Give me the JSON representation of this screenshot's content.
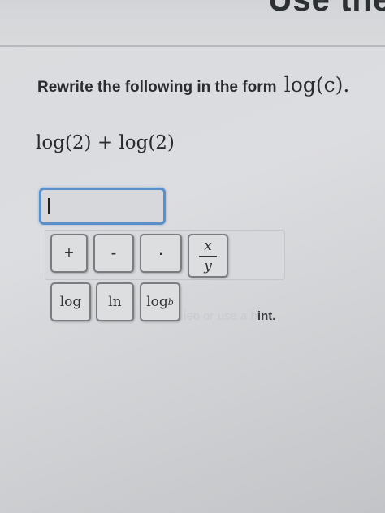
{
  "header": {
    "partial_heading": "Use the"
  },
  "question": {
    "prompt": "Rewrite the following in the form",
    "form": "log(c)."
  },
  "expression": "log(2) + log(2)",
  "answer": {
    "value": ""
  },
  "palette": {
    "plus": "+",
    "minus": "-",
    "dot": "·",
    "frac_num": "x",
    "frac_den": "y",
    "log": "log",
    "ln": "ln",
    "logb_base": "log",
    "logb_sub": "b"
  },
  "hint": {
    "faded": "ieo or use a h",
    "visible": "int."
  }
}
